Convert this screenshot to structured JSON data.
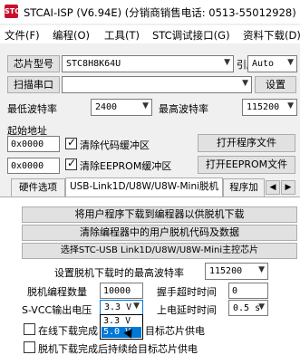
{
  "app": {
    "icon": "STC",
    "title": "STCAI-ISP (V6.94E) (分销商销售电话: 0513-55012928)"
  },
  "menu": [
    "文件(F)",
    "编程(O)",
    "工具(T)",
    "STC调试接口(G)",
    "资料下载(D)"
  ],
  "chip": {
    "label": "芯片型号",
    "value": "STC8H8K64U",
    "pins_label": "引脚数",
    "pins_value": "Auto"
  },
  "port": {
    "scan_button": "扫描串口",
    "value": "",
    "settings_button": "设置"
  },
  "baud": {
    "min_label": "最低波特率",
    "min_value": "2400",
    "max_label": "最高波特率",
    "max_value": "115200"
  },
  "start_address": {
    "label": "起始地址",
    "code_value": "0x0000",
    "clear_code_label": "清除代码缓冲区",
    "clear_code_checked": true,
    "open_program_button": "打开程序文件",
    "eeprom_value": "0x0000",
    "clear_eeprom_label": "清除EEPROM缓冲区",
    "clear_eeprom_checked": true,
    "open_eeprom_button": "打开EEPROM文件"
  },
  "tabs": [
    {
      "label": "硬件选项",
      "active": false
    },
    {
      "label": "USB-Link1D/U8W/U8W-Mini脱机",
      "active": true
    },
    {
      "label": "程序加",
      "active": false
    }
  ],
  "offline": {
    "download_user_program_button": "将用户程序下载到编程器以供脱机下载",
    "clear_program_button": "清除编程器中的用户脱机代码及数据",
    "select_master_button": "选择STC-USB Link1D/U8W/U8W-Mini主控芯片",
    "max_baud_label": "设置脱机下载时的最高波特率",
    "max_baud_value": "115200",
    "program_count_label": "脱机编程数量",
    "program_count_value": "10000",
    "handshake_timeout_label": "握手超时时间",
    "handshake_timeout_value": "0",
    "svcc_label": "S-VCC输出电压",
    "svcc_value": "3.3 V",
    "svcc_options": [
      "3.3 V",
      "5.0 V"
    ],
    "svcc_selected_option": "5.0 V",
    "power_delay_label": "上电延时时间",
    "power_delay_value": "0.5 s",
    "online_download_label": "在线下载完成",
    "online_download_suffix": "目标芯片供电",
    "online_download_checked": false,
    "offline_download_label": "脱机下载完成后持续给目标芯片供电",
    "offline_download_checked": false
  }
}
